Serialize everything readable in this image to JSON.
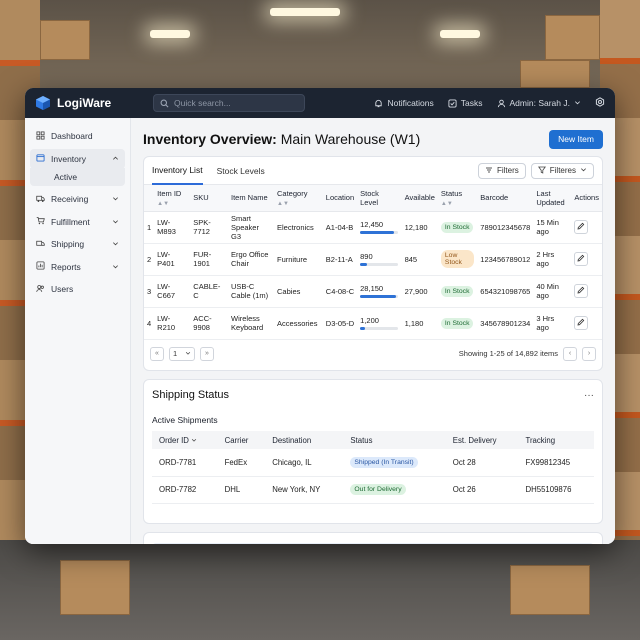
{
  "app": {
    "name": "LogiWare"
  },
  "topbar": {
    "search_placeholder": "Quick search...",
    "notifications_label": "Notifications",
    "tasks_label": "Tasks",
    "user_label": "Admin: Sarah J."
  },
  "sidebar": {
    "items": [
      {
        "label": "Dashboard",
        "icon": "grid-icon"
      },
      {
        "label": "Inventory",
        "icon": "box-icon"
      },
      {
        "label": "Receiving",
        "icon": "truck-icon"
      },
      {
        "label": "Fulfillment",
        "icon": "cart-icon"
      },
      {
        "label": "Shipping",
        "icon": "ship-icon"
      },
      {
        "label": "Reports",
        "icon": "chart-icon"
      },
      {
        "label": "Users",
        "icon": "users-icon"
      }
    ],
    "inventory_sub": "Active"
  },
  "main": {
    "title_bold": "Inventory Overview:",
    "title_rest": " Main Warehouse (W1)",
    "new_item_label": "New Item"
  },
  "inventory": {
    "tabs": [
      "Inventory List",
      "Stock Levels"
    ],
    "filters_label": "Filters",
    "filteres_label": "Filteres",
    "columns": [
      "Item ID",
      "SKU",
      "Item Name",
      "Category",
      "Location",
      "Stock Level",
      "Available",
      "Status",
      "Barcode",
      "Last Updated",
      "Actions"
    ],
    "rows": [
      {
        "n": "1",
        "id": "LW-M893",
        "sku": "SPK-7712",
        "name": "Smart Speaker G3",
        "category": "Electronics",
        "location": "A1-04-B",
        "stock": "12,450",
        "stock_fraction": 0.9,
        "available": "12,180",
        "status": "In Stock",
        "barcode": "789012345678",
        "updated": "15 Min ago"
      },
      {
        "n": "2",
        "id": "LW-P401",
        "sku": "FUR-1901",
        "name": "Ergo Office Chair",
        "category": "Furniture",
        "location": "B2-11-A",
        "stock": "890",
        "stock_fraction": 0.18,
        "available": "845",
        "status": "Low Stock",
        "barcode": "123456789012",
        "updated": "2 Hrs ago"
      },
      {
        "n": "3",
        "id": "LW-C667",
        "sku": "CABLE-C",
        "name": "USB-C Cable (1m)",
        "category": "Cabies",
        "location": "C4-08-C",
        "stock": "28,150",
        "stock_fraction": 0.95,
        "available": "27,900",
        "status": "In Stock",
        "barcode": "654321098765",
        "updated": "40 Min ago"
      },
      {
        "n": "4",
        "id": "LW-R210",
        "sku": "ACC-9908",
        "name": "Wireless Keyboard",
        "category": "Accessories",
        "location": "D3-05-D",
        "stock": "1,200",
        "stock_fraction": 0.12,
        "available": "1,180",
        "status": "In Stock",
        "barcode": "345678901234",
        "updated": "3 Hrs ago"
      }
    ],
    "page_value": "1",
    "showing": "Showing 1-25 of 14,892 items"
  },
  "shipping": {
    "title": "Shipping Status",
    "subtitle": "Active Shipments",
    "columns": [
      "Order ID",
      "Carrier",
      "Destination",
      "Status",
      "Est. Delivery",
      "Tracking"
    ],
    "rows": [
      {
        "order": "ORD-7781",
        "carrier": "FedEx",
        "destination": "Chicago, IL",
        "status": "Shipped (In Transit)",
        "delivery": "Oct 28",
        "tracking": "FX99812345"
      },
      {
        "order": "ORD-7782",
        "carrier": "DHL",
        "destination": "New York, NY",
        "status": "Out for Delivery",
        "delivery": "Oct 26",
        "tracking": "DH55109876"
      }
    ]
  },
  "colors": {
    "accent": "#1f6fd1",
    "topbar": "#1c2431",
    "in_stock": "#dcf2e1",
    "low_stock": "#fbe6c9"
  }
}
